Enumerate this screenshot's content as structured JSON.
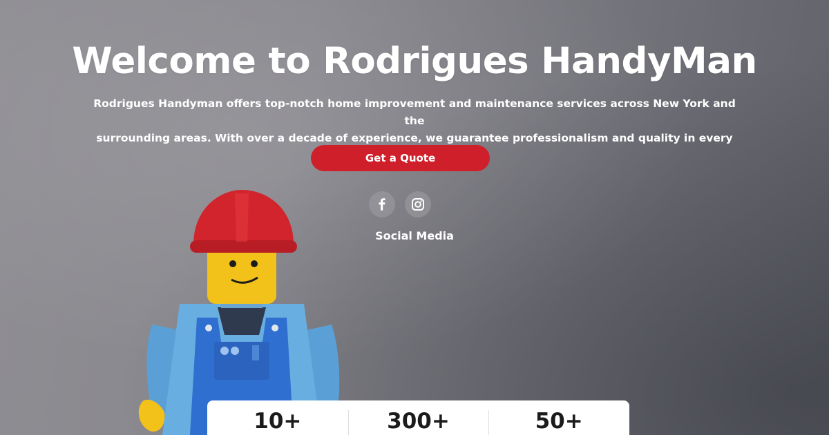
{
  "hero": {
    "title": "Welcome to Rodrigues HandyMan",
    "subtitle_line1": "Rodrigues Handyman offers top-notch home improvement and maintenance services across New York and the",
    "subtitle_line2": "surrounding areas. With over a decade of experience, we guarantee professionalism and quality in every project.",
    "cta_label": "Get a Quote"
  },
  "social": {
    "label": "Social Media",
    "links": [
      {
        "icon": "facebook-icon"
      },
      {
        "icon": "instagram-icon"
      }
    ]
  },
  "stats": [
    {
      "value": "10+"
    },
    {
      "value": "300+"
    },
    {
      "value": "50+"
    }
  ],
  "colors": {
    "accent": "#cf1f2a",
    "text": "#ffffff",
    "background": "#86858b"
  },
  "background_image": {
    "icon": "lego-construction-worker-figure"
  }
}
